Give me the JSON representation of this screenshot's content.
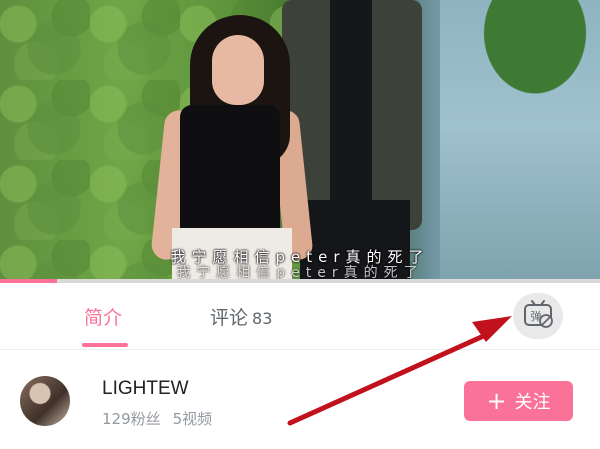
{
  "video": {
    "subtitle_primary": "我宁愿相信peter真的死了",
    "subtitle_secondary": "我宁愿相信peter真的死了",
    "progress_fraction": 0.095
  },
  "tabs": [
    {
      "label": "简介",
      "active": true
    },
    {
      "label": "评论",
      "count": "83",
      "active": false
    }
  ],
  "danmaku": {
    "icon": "danmaku-off-icon",
    "glyph": "弹"
  },
  "uploader": {
    "name": "LIGHTEW",
    "fans": "129粉丝",
    "videos": "5视频"
  },
  "follow_button": {
    "plus": "+",
    "label": "关注"
  },
  "colors": {
    "accent": "#fb7299",
    "annotation_arrow": "#c0111c"
  }
}
